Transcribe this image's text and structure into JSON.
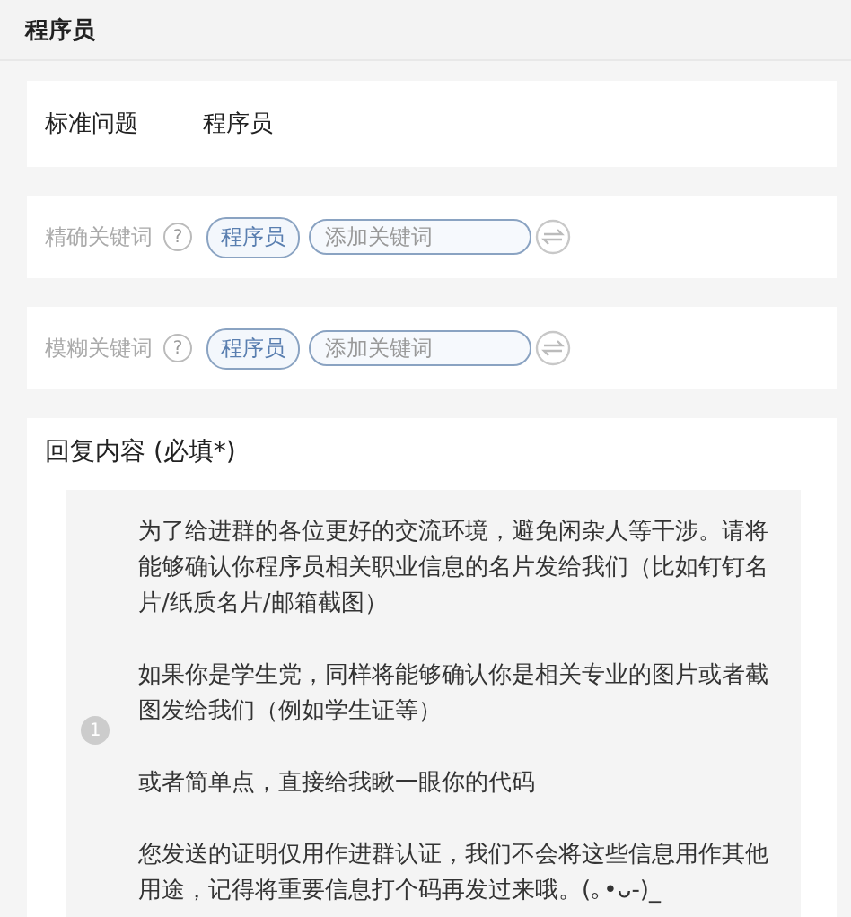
{
  "header": {
    "title": "程序员"
  },
  "standard_question": {
    "label": "标准问题",
    "value": "程序员"
  },
  "keyword_rows": [
    {
      "label": "精确关键词",
      "help": "?",
      "tags": [
        "程序员"
      ],
      "placeholder": "添加关键词"
    },
    {
      "label": "模糊关键词",
      "help": "?",
      "tags": [
        "程序员"
      ],
      "placeholder": "添加关键词"
    }
  ],
  "reply": {
    "label": "回复内容 (必填*)",
    "messages": [
      {
        "number": "1",
        "paragraphs": [
          "为了给进群的各位更好的交流环境，避免闲杂人等干涉。请将能够确认你程序员相关职业信息的名片发给我们（比如钉钉名片/纸质名片/邮箱截图）",
          "如果你是学生党，同样将能够确认你是相关专业的图片或者截图发给我们（例如学生证等）",
          "或者简单点，直接给我瞅一眼你的代码",
          "您发送的证明仅用作进群认证，我们不会将这些信息用作其他用途，记得将重要信息打个码再发过来哦。(｡•ᴗ-)_"
        ]
      }
    ]
  }
}
